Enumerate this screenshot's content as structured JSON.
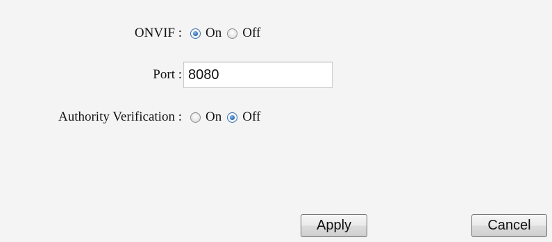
{
  "onvif": {
    "label": "ONVIF :",
    "options": [
      "On",
      "Off"
    ],
    "selected": "On"
  },
  "port": {
    "label": "Port :",
    "value": "8080",
    "placeholder": ""
  },
  "authority": {
    "label": "Authority Verification :",
    "options": [
      "On",
      "Off"
    ],
    "selected": "Off"
  },
  "buttons": {
    "apply": "Apply",
    "cancel": "Cancel"
  },
  "colors": {
    "background": "#f4f4f4",
    "radio_checked": "#2f6db4"
  }
}
